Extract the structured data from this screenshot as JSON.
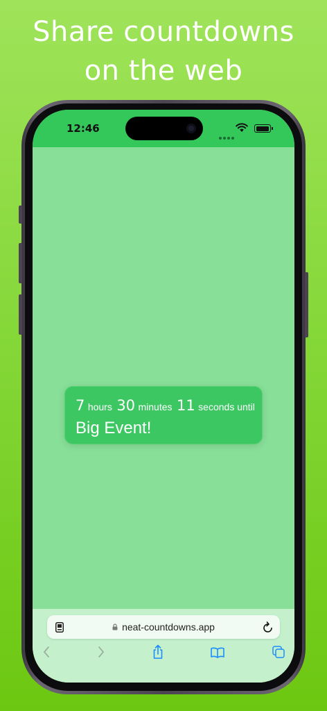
{
  "headline": {
    "line1": "Share countdowns",
    "line2": "on the web"
  },
  "status_bar": {
    "time": "12:46"
  },
  "countdown": {
    "hours": "7",
    "hours_label": "hours",
    "minutes": "30",
    "minutes_label": "minutes",
    "seconds": "11",
    "seconds_label": "seconds until",
    "event_name": "Big Event!"
  },
  "browser": {
    "url": "neat-countdowns.app"
  },
  "colors": {
    "accent": "#34c759",
    "card": "#3dc762",
    "page_bg": "#88df98",
    "toolbar_blue": "#1a8cff"
  }
}
